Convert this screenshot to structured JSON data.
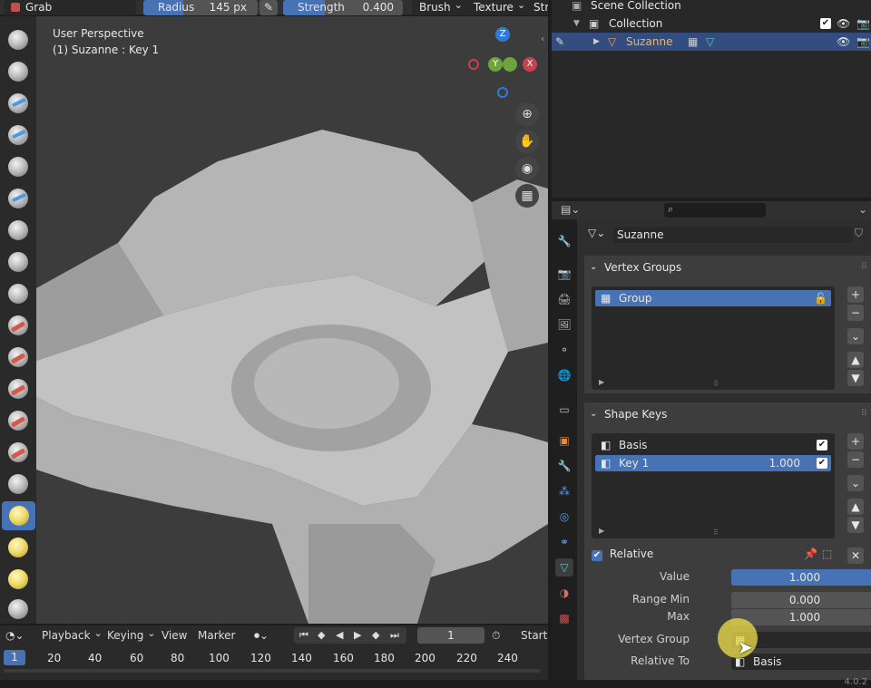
{
  "header": {
    "mode_label": "Grab",
    "radius": {
      "label": "Radius",
      "value": "145 px",
      "fill_fraction": 0.35
    },
    "strength": {
      "label": "Strength",
      "value": "0.400",
      "fill_fraction": 0.35
    },
    "brush_label": "Brush",
    "texture_label": "Texture",
    "stroke_label": "Str"
  },
  "viewport": {
    "perspective_label": "User Perspective",
    "object_label": "(1) Suzanne : Key 1",
    "gizmo_axes": {
      "z": "Z",
      "y": "Y",
      "x": "X"
    }
  },
  "outliner": {
    "scene_collection": "Scene Collection",
    "collection": "Collection",
    "object": "Suzanne"
  },
  "properties": {
    "search_placeholder": "",
    "object_name": "Suzanne",
    "vertex_groups": {
      "title": "Vertex Groups",
      "items": [
        "Group"
      ]
    },
    "shape_keys": {
      "title": "Shape Keys",
      "items": [
        {
          "name": "Basis",
          "value": ""
        },
        {
          "name": "Key 1",
          "value": "1.000"
        }
      ],
      "relative_label": "Relative",
      "fields": {
        "value_label": "Value",
        "value": "1.000",
        "range_min_label": "Range Min",
        "range_min": "0.000",
        "max_label": "Max",
        "max": "1.000",
        "vertex_group_label": "Vertex Group",
        "vertex_group": "",
        "relative_to_label": "Relative To",
        "relative_to": "Basis"
      }
    }
  },
  "timeline": {
    "playback": "Playback",
    "keying": "Keying",
    "view": "View",
    "marker": "Marker",
    "current_frame": "1",
    "start_label": "Start",
    "ticks": [
      "1",
      "20",
      "40",
      "60",
      "80",
      "100",
      "120",
      "140",
      "160",
      "180",
      "200",
      "220",
      "240"
    ]
  },
  "version": "4.0.2",
  "colors": {
    "accent": "#4772b3",
    "cursor_highlight": "#f1e24a"
  }
}
